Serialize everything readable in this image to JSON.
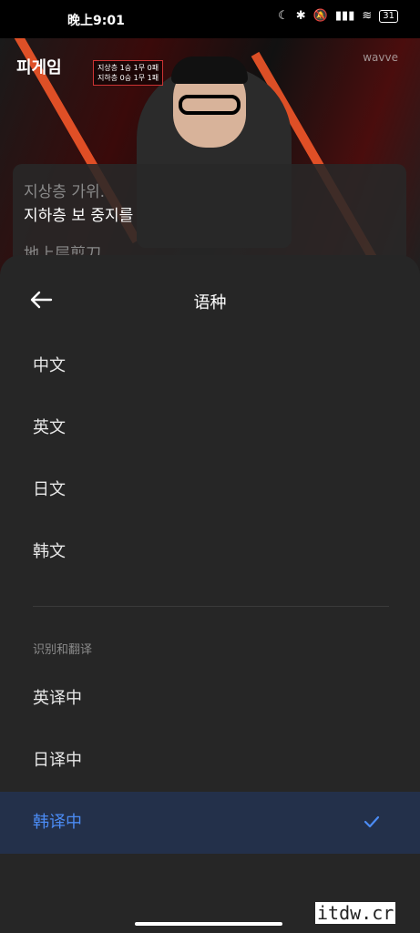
{
  "status": {
    "time": "晚上9:01",
    "battery": "31"
  },
  "video": {
    "logo_text": "피게임",
    "score_line1": "지상층 1승 1무 0패",
    "score_line2": "지하층 0승 1무 1패",
    "watermark": "wavve"
  },
  "subtitles": {
    "line1": "지상층 가위.",
    "line2": "지하층 보 중지를",
    "line3": "地上层剪刀"
  },
  "sheet": {
    "title": "语种",
    "languages": [
      {
        "label": "中文"
      },
      {
        "label": "英文"
      },
      {
        "label": "日文"
      },
      {
        "label": "韩文"
      }
    ],
    "section_label": "识别和翻译",
    "translations": [
      {
        "label": "英译中",
        "selected": false
      },
      {
        "label": "日译中",
        "selected": false
      },
      {
        "label": "韩译中",
        "selected": true
      }
    ]
  },
  "accent_color": "#4b8bf4",
  "site_watermark": "itdw.cr"
}
